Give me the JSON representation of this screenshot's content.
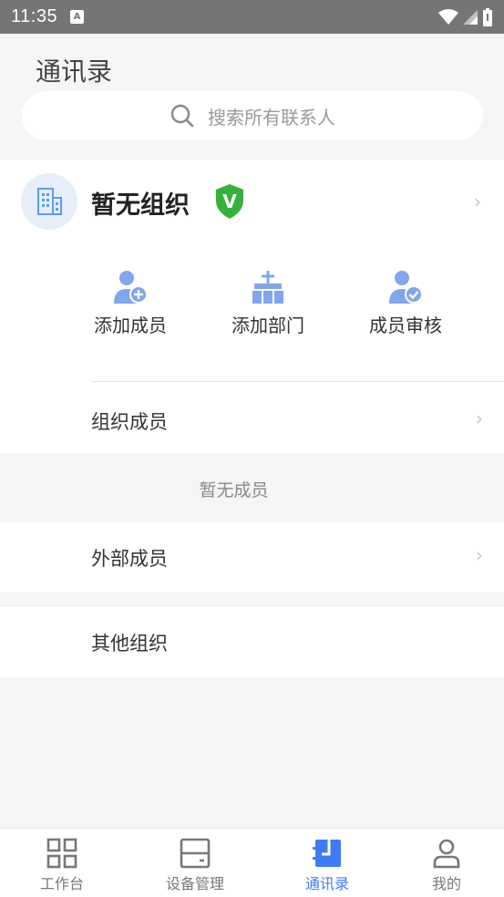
{
  "status_bar": {
    "time": "11:35",
    "indicator": "A"
  },
  "header": {
    "title": "通讯录"
  },
  "search": {
    "placeholder": "搜索所有联系人"
  },
  "org": {
    "name": "暂无组织",
    "verified_badge": "V",
    "actions": [
      {
        "label": "添加成员",
        "icon": "add-member-icon"
      },
      {
        "label": "添加部门",
        "icon": "add-department-icon"
      },
      {
        "label": "成员审核",
        "icon": "member-review-icon"
      }
    ],
    "members_label": "组织成员",
    "empty_text": "暂无成员"
  },
  "external": {
    "label": "外部成员"
  },
  "other": {
    "label": "其他组织"
  },
  "tabs": [
    {
      "label": "工作台",
      "icon": "grid-icon",
      "active": false
    },
    {
      "label": "设备管理",
      "icon": "device-icon",
      "active": false
    },
    {
      "label": "通讯录",
      "icon": "contacts-icon",
      "active": true
    },
    {
      "label": "我的",
      "icon": "profile-icon",
      "active": false
    }
  ],
  "colors": {
    "accent": "#3e7cf7",
    "icon_blue": "#7fa6ee",
    "verify_green": "#35b13a"
  }
}
